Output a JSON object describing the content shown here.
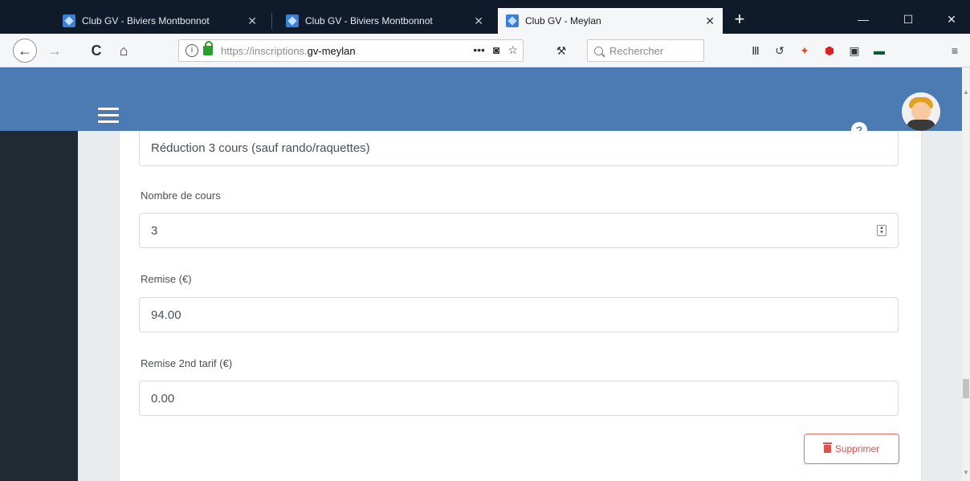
{
  "browser": {
    "tabs": [
      {
        "title": "Club GV - Biviers Montbonnot",
        "active": false
      },
      {
        "title": "Club GV - Biviers Montbonnot",
        "active": false
      },
      {
        "title": "Club GV - Meylan",
        "active": true
      }
    ],
    "tab_close": "✕",
    "new_tab": "+",
    "window_controls": {
      "minimize": "—",
      "maximize": "☐",
      "close": "✕"
    },
    "nav": {
      "back": "←",
      "forward": "→",
      "reload": "C",
      "home": "⌂"
    },
    "url": {
      "info": "i",
      "prefix": "https://inscriptions.",
      "host": "gv-meylan",
      "fade": ".",
      "actions": "•••"
    },
    "search_placeholder": "Rechercher",
    "toolbar_icons": [
      "library-icon",
      "history-icon",
      "extension-icon",
      "adblock-icon",
      "reader-icon",
      "extension-2-icon",
      "menu-icon"
    ]
  },
  "app": {
    "header_color": "#4c7bb3",
    "help_label": "?"
  },
  "form": {
    "description_value": "Réduction 3 cours (sauf rando/raquettes)",
    "courses": {
      "label": "Nombre de cours",
      "value": "3"
    },
    "discount": {
      "label": "Remise (€)",
      "value": "94.00"
    },
    "discount2": {
      "label": "Remise 2nd tarif (€)",
      "value": "0.00"
    },
    "delete_label": "Supprimer",
    "delete_color": "#d9534f"
  }
}
